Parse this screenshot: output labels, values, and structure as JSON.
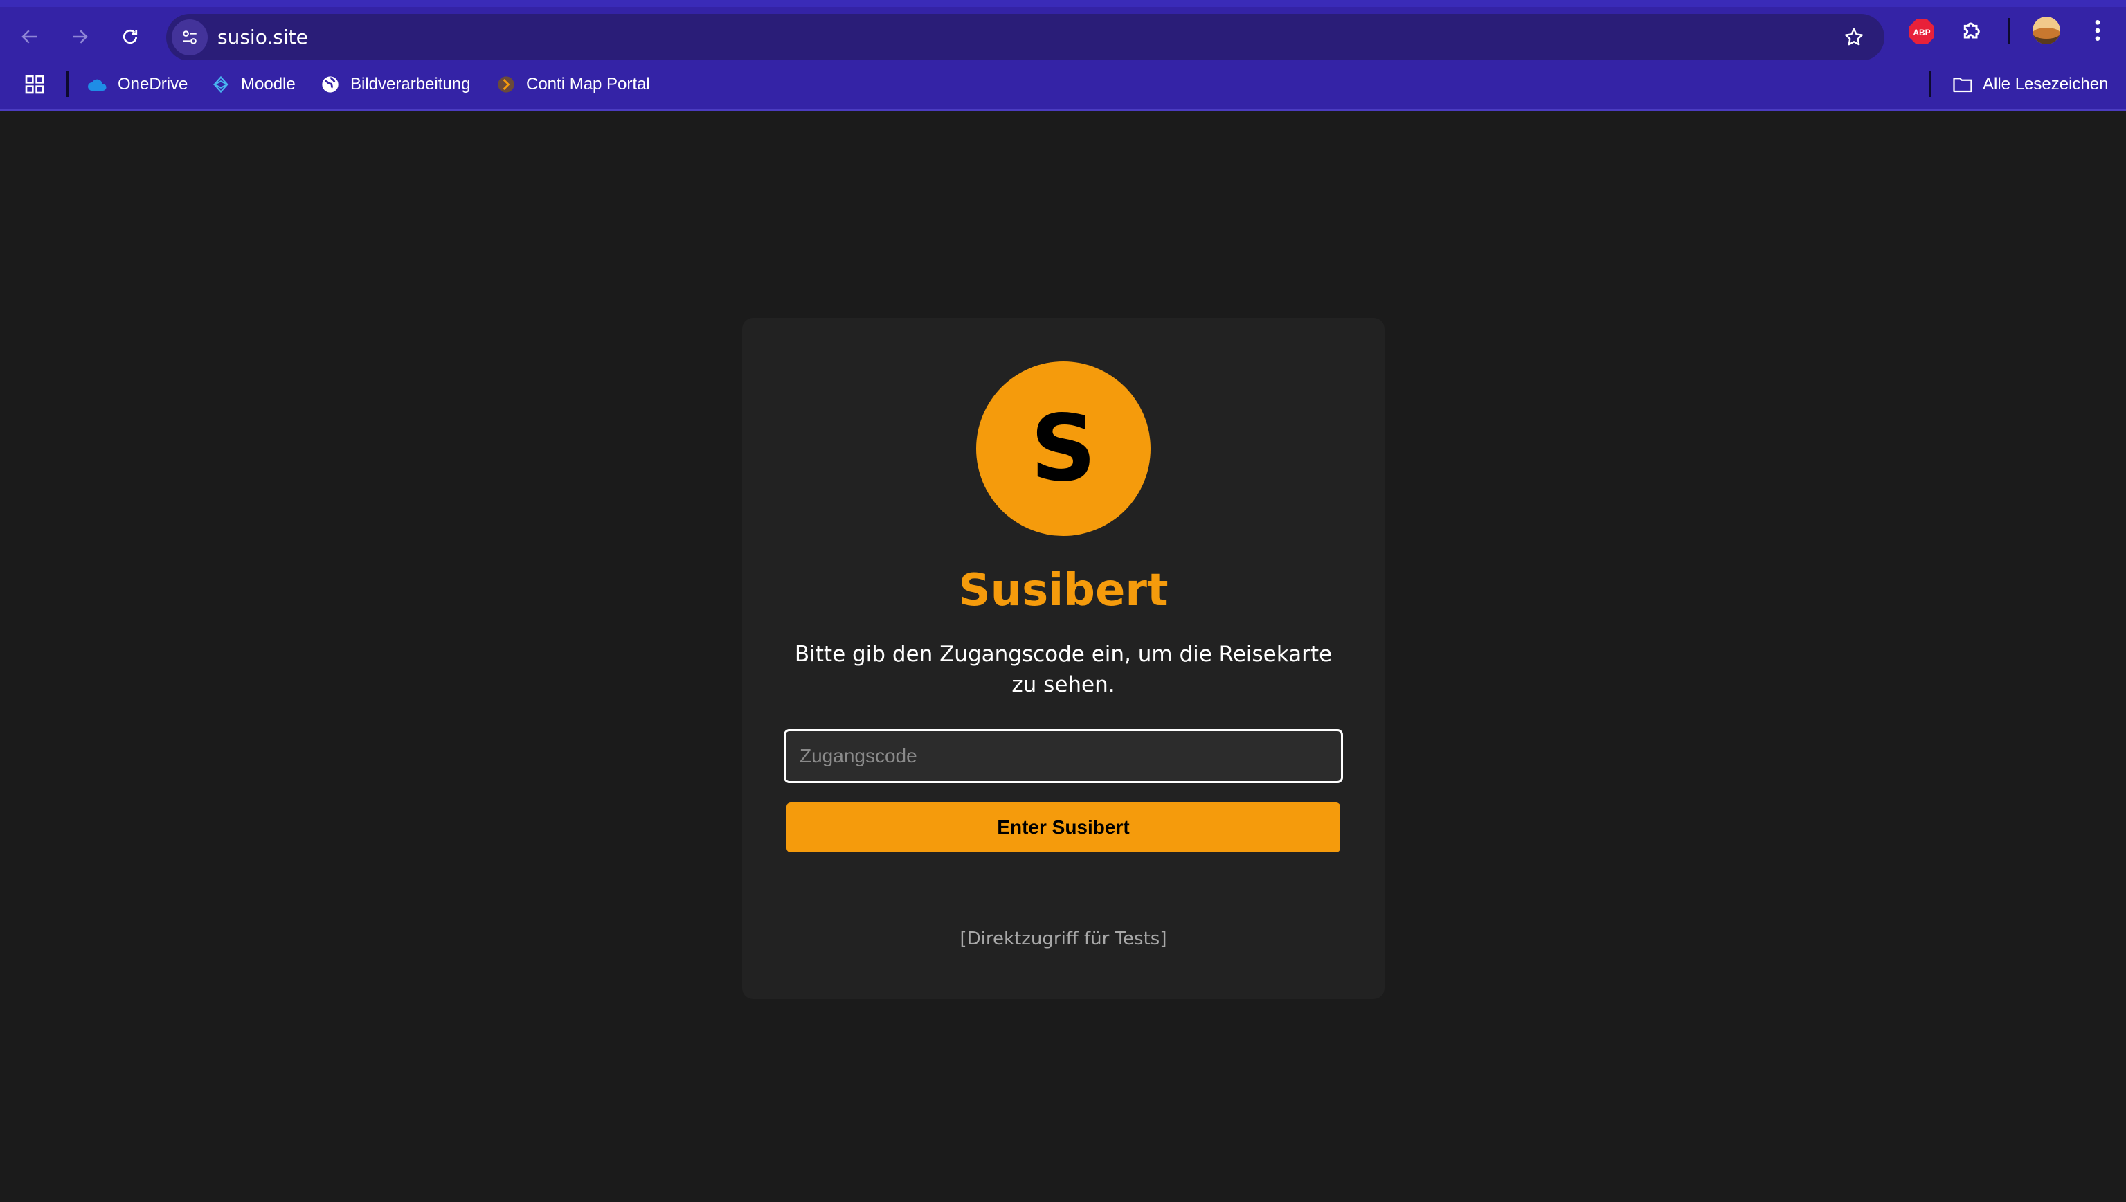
{
  "browser": {
    "url": "susio.site",
    "bookmarks": [
      {
        "label": "OneDrive",
        "icon": "onedrive-icon"
      },
      {
        "label": "Moodle",
        "icon": "moodle-icon"
      },
      {
        "label": "Bildverarbeitung",
        "icon": "globe-icon"
      },
      {
        "label": "Conti Map Portal",
        "icon": "conti-icon"
      }
    ],
    "all_bookmarks_label": "Alle Lesezeichen",
    "extension_label": "ABP"
  },
  "page": {
    "logo_letter": "S",
    "title": "Susibert",
    "subtitle": "Bitte gib den Zugangscode ein, um die Reisekarte zu sehen.",
    "code_placeholder": "Zugangscode",
    "code_value": "",
    "enter_button_label": "Enter Susibert",
    "direct_access_link": "[Direktzugriff für Tests]"
  },
  "colors": {
    "accent": "#f59b0c",
    "chrome": "#3423a6",
    "background": "#1b1b1b",
    "card": "#222222"
  }
}
